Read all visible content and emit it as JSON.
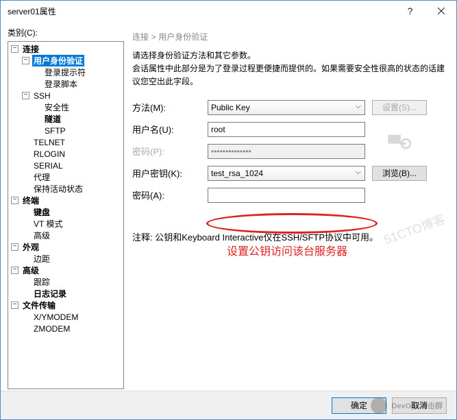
{
  "title": "server01属性",
  "left_label": "类别(C):",
  "tree": {
    "n0": "连接",
    "n0_0": "用户身份验证",
    "n0_0_0": "登录提示符",
    "n0_0_1": "登录脚本",
    "n0_1": "SSH",
    "n0_1_0": "安全性",
    "n0_1_1": "隧道",
    "n0_1_2": "SFTP",
    "n0_2": "TELNET",
    "n0_3": "RLOGIN",
    "n0_4": "SERIAL",
    "n0_5": "代理",
    "n0_6": "保持活动状态",
    "n1": "终端",
    "n1_0": "键盘",
    "n1_1": "VT 模式",
    "n1_2": "高级",
    "n2": "外观",
    "n2_0": "边距",
    "n3": "高级",
    "n3_0": "跟踪",
    "n3_1": "日志记录",
    "n4": "文件传输",
    "n4_0": "X/YMODEM",
    "n4_1": "ZMODEM"
  },
  "breadcrumb": {
    "a": "连接",
    "sep": ">",
    "b": "用户身份验证"
  },
  "desc1": "请选择身份验证方法和其它参数。",
  "desc2": "会话属性中此部分是为了登录过程更便捷而提供的。如果需要安全性很高的状态的话建议您空出此字段。",
  "form": {
    "method_l": "方法(M):",
    "method_v": "Public Key",
    "settings_btn": "设置(S)...",
    "user_l": "用户名(U):",
    "user_v": "root",
    "pass_l": "密码(P):",
    "pass_v": "••••••••••••••",
    "ukey_l": "用户密钥(K):",
    "ukey_v": "test_rsa_1024",
    "browse_btn": "浏览(B)...",
    "pass2_l": "密码(A):",
    "pass2_v": ""
  },
  "red_annot": "设置公钥访问该台服务器",
  "note": "注释: 公钥和Keyboard Interactive仅在SSH/SFTP协议中可用。",
  "footer": {
    "ok": "确定",
    "cancel": "取消"
  },
  "watermark": "DevOps冲击群",
  "watermark2": "51CTO博客"
}
